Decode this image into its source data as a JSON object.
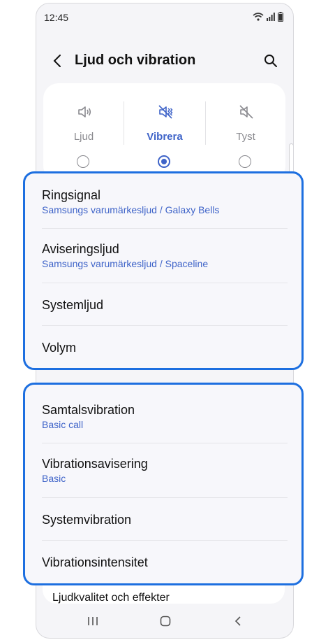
{
  "status": {
    "time": "12:45"
  },
  "header": {
    "title": "Ljud och vibration"
  },
  "modes": [
    {
      "label": "Ljud",
      "selected": false,
      "icon": "speaker-icon"
    },
    {
      "label": "Vibrera",
      "selected": true,
      "icon": "vibrate-icon"
    },
    {
      "label": "Tyst",
      "selected": false,
      "icon": "mute-icon"
    }
  ],
  "sound_group": [
    {
      "title": "Ringsignal",
      "subtitle": "Samsungs varumärkesljud / Galaxy Bells"
    },
    {
      "title": "Aviseringsljud",
      "subtitle": "Samsungs varumärkesljud / Spaceline"
    },
    {
      "title": "Systemljud"
    },
    {
      "title": "Volym"
    }
  ],
  "vibration_group": [
    {
      "title": "Samtalsvibration",
      "subtitle": "Basic call"
    },
    {
      "title": "Vibrationsavisering",
      "subtitle": "Basic"
    },
    {
      "title": "Systemvibration"
    },
    {
      "title": "Vibrationsintensitet"
    }
  ],
  "more": {
    "label": "Ljudkvalitet och effekter"
  },
  "colors": {
    "accent": "#3e63c8",
    "highlight": "#1d6fe0"
  }
}
